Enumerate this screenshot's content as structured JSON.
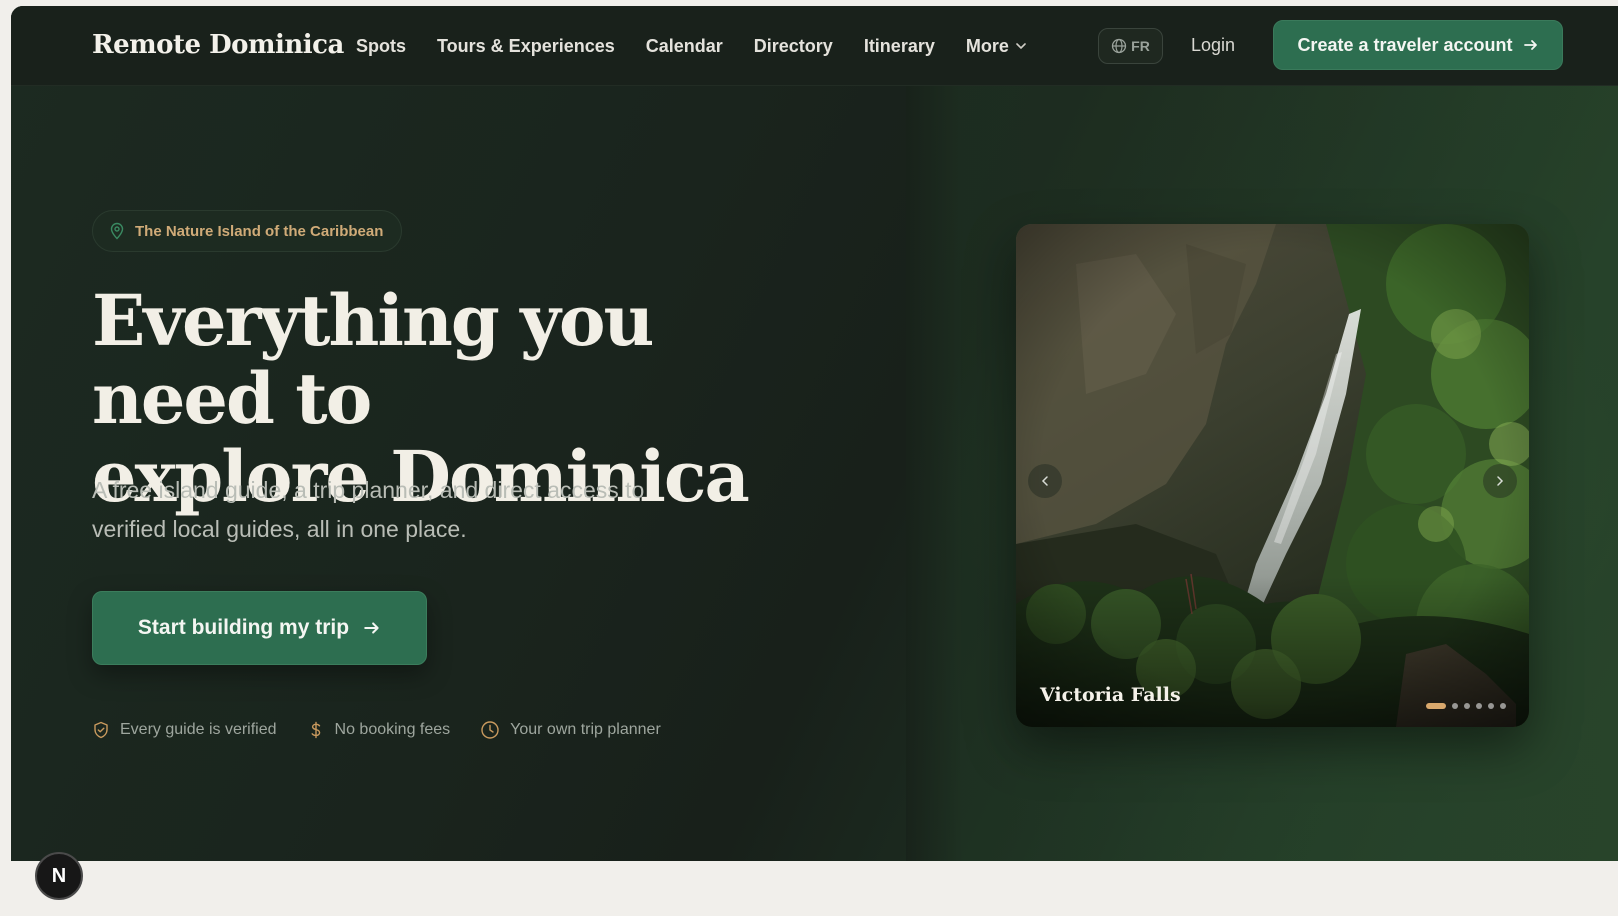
{
  "nav": {
    "logo": "Remote Dominica",
    "links": [
      "Spots",
      "Tours & Experiences",
      "Calendar",
      "Directory",
      "Itinerary",
      "More"
    ],
    "lang_label": "FR",
    "login_label": "Login",
    "cta_label": "Create a traveler account"
  },
  "hero": {
    "badge": "The Nature Island of the Caribbean",
    "headline_line1": "Everything you need to",
    "headline_line2": "explore Dominica",
    "subtext": "A free island guide, a trip planner, and direct access to verified local guides, all in one place.",
    "cta_label": "Start building my trip",
    "trust": [
      "Every guide is verified",
      "No booking fees",
      "Your own trip planner"
    ]
  },
  "carousel": {
    "caption": "Victoria Falls",
    "slide_count": 6,
    "active_slide": 1
  },
  "colors": {
    "primary": "#2d6e50",
    "accent": "#d0ab78",
    "background": "#182019",
    "text": "#f2efe6"
  },
  "icons": {
    "badge": "map-pin-icon",
    "lang": "globe-icon",
    "more": "chevron-down-icon",
    "cta": "arrow-right-icon",
    "trust": [
      "shield-check-icon",
      "dollar-icon",
      "clock-icon"
    ]
  },
  "dev_badge": "N"
}
